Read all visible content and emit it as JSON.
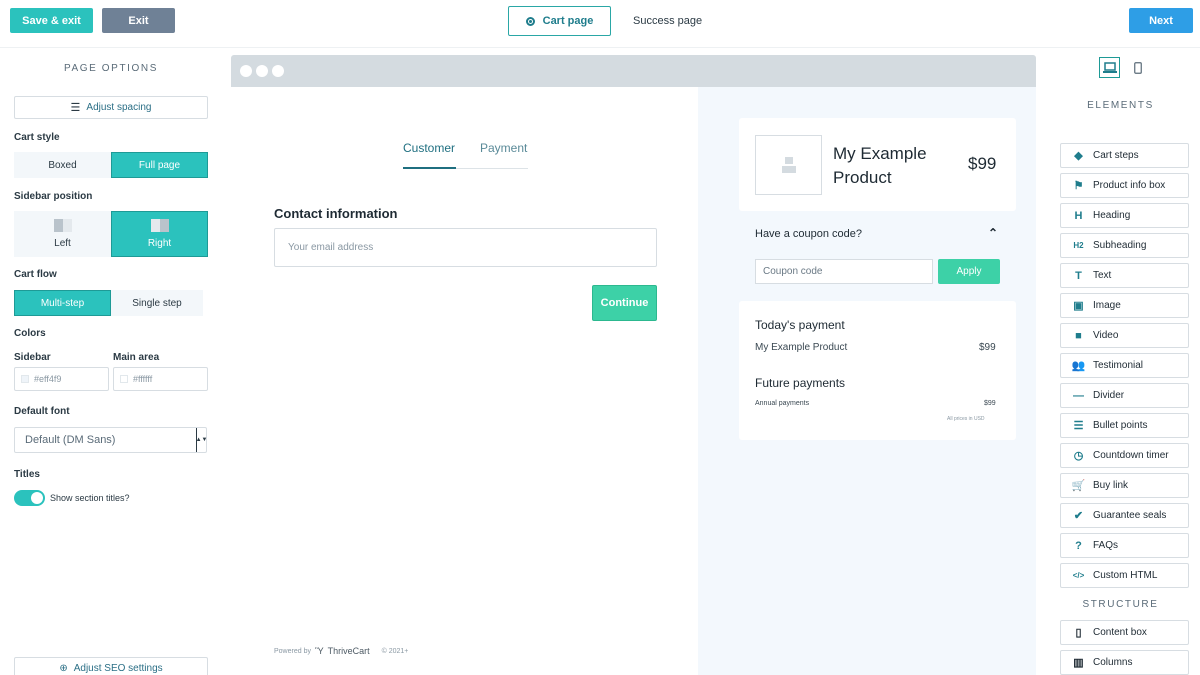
{
  "topbar": {
    "save_exit": "Save & exit",
    "exit": "Exit",
    "cart_page": "Cart page",
    "success_page": "Success page",
    "next": "Next"
  },
  "left_panel": {
    "title": "PAGE OPTIONS",
    "adjust_spacing": "Adjust spacing",
    "cart_style": {
      "label": "Cart style",
      "options": [
        "Boxed",
        "Full page"
      ],
      "selected": "Full page"
    },
    "sidebar_position": {
      "label": "Sidebar position",
      "options": [
        "Left",
        "Right"
      ],
      "selected": "Right"
    },
    "cart_flow": {
      "label": "Cart flow",
      "options": [
        "Multi-step",
        "Single step"
      ],
      "selected": "Multi-step"
    },
    "colors": {
      "label": "Colors",
      "sidebar_label": "Sidebar",
      "sidebar_value": "#eff4f9",
      "main_label": "Main area",
      "main_value": "#ffffff"
    },
    "default_font": {
      "label": "Default font",
      "value": "Default (DM Sans)"
    },
    "titles": {
      "label": "Titles",
      "toggle_label": "Show section titles?",
      "enabled": true
    },
    "adjust_seo": "Adjust SEO settings"
  },
  "checkout": {
    "steps": [
      "Customer",
      "Payment"
    ],
    "active_step": "Customer",
    "contact_heading": "Contact information",
    "email_placeholder": "Your email address",
    "continue": "Continue",
    "powered_by": "Powered by",
    "brand": "ThriveCart",
    "copyright": "© 2021+"
  },
  "order_sidebar": {
    "product_name": "My Example Product",
    "product_price": "$99",
    "coupon_question": "Have a coupon code?",
    "coupon_placeholder": "Coupon code",
    "apply": "Apply",
    "todays_payment": "Today's payment",
    "line_item": "My Example Product",
    "line_price": "$99",
    "future_payments": "Future payments",
    "annual_label": "Annual payments",
    "annual_price": "$99",
    "currency_note": "All prices in USD"
  },
  "right_panel": {
    "elements_title": "ELEMENTS",
    "elements": [
      {
        "label": "Cart steps",
        "icon": "diamond-arrow-icon"
      },
      {
        "label": "Product info box",
        "icon": "flag-icon"
      },
      {
        "label": "Heading",
        "icon": "heading-icon"
      },
      {
        "label": "Subheading",
        "icon": "subheading-icon"
      },
      {
        "label": "Text",
        "icon": "text-icon"
      },
      {
        "label": "Image",
        "icon": "image-icon"
      },
      {
        "label": "Video",
        "icon": "video-icon"
      },
      {
        "label": "Testimonial",
        "icon": "users-icon"
      },
      {
        "label": "Divider",
        "icon": "divider-icon"
      },
      {
        "label": "Bullet points",
        "icon": "list-icon"
      },
      {
        "label": "Countdown timer",
        "icon": "clock-icon"
      },
      {
        "label": "Buy link",
        "icon": "cart-icon"
      },
      {
        "label": "Guarantee seals",
        "icon": "badge-check-icon"
      },
      {
        "label": "FAQs",
        "icon": "question-icon"
      },
      {
        "label": "Custom HTML",
        "icon": "code-icon"
      }
    ],
    "structure_title": "STRUCTURE",
    "structure": [
      {
        "label": "Content box",
        "icon": "box-icon"
      },
      {
        "label": "Columns",
        "icon": "columns-icon"
      }
    ]
  },
  "colors": {
    "accent": "#2bc2bd",
    "primary": "#2e9ee6",
    "success": "#3dd1a7",
    "sidebar_bg": "#f3f8fd"
  }
}
